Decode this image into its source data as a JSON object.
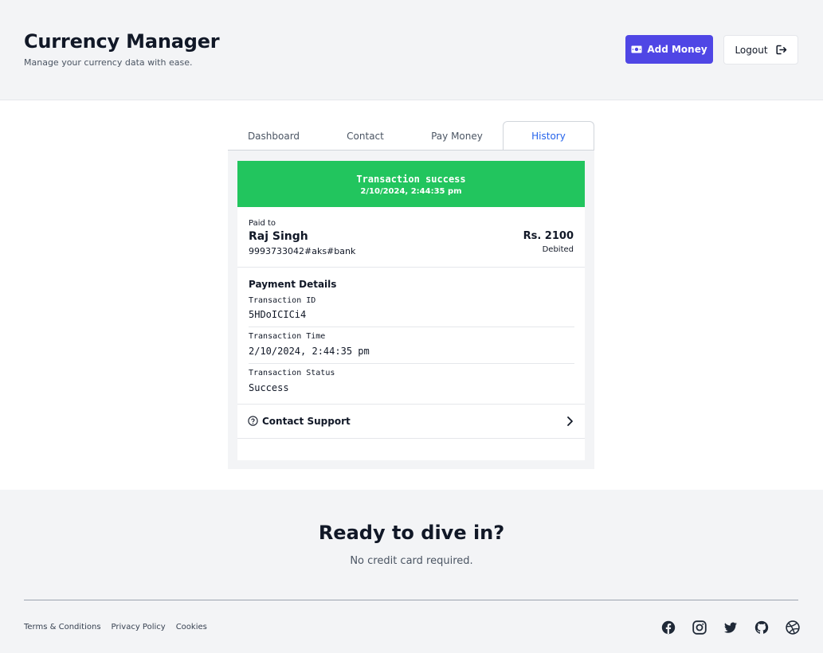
{
  "header": {
    "title": "Currency Manager",
    "subtitle": "Manage your currency data with ease.",
    "add_money_label": "Add Money",
    "logout_label": "Logout"
  },
  "tabs": [
    {
      "label": "Dashboard",
      "active": false
    },
    {
      "label": "Contact",
      "active": false
    },
    {
      "label": "Pay Money",
      "active": false
    },
    {
      "label": "History",
      "active": true
    }
  ],
  "transaction": {
    "banner_title": "Transaction success",
    "banner_time": "2/10/2024, 2:44:35 pm",
    "paid_to_label": "Paid to",
    "payee_name": "Raj Singh",
    "payee_upi": "9993733042#aks#bank",
    "amount": "Rs. 2100",
    "direction": "Debited",
    "details_heading": "Payment Details",
    "details": [
      {
        "label": "Transaction ID",
        "value": "5HDoICICi4"
      },
      {
        "label": "Transaction Time",
        "value": "2/10/2024, 2:44:35 pm"
      },
      {
        "label": "Transaction Status",
        "value": "Success"
      }
    ],
    "support_label": "Contact Support"
  },
  "footer": {
    "cta_title": "Ready to dive in?",
    "cta_subtitle": "No credit card required.",
    "links": [
      "Terms & Conditions",
      "Privacy Policy",
      "Cookies"
    ],
    "social_icons": [
      "facebook-icon",
      "instagram-icon",
      "twitter-icon",
      "github-icon",
      "dribbble-icon"
    ]
  },
  "colors": {
    "accent": "#4f46e5",
    "success": "#22c55e",
    "active_tab": "#2563eb"
  }
}
